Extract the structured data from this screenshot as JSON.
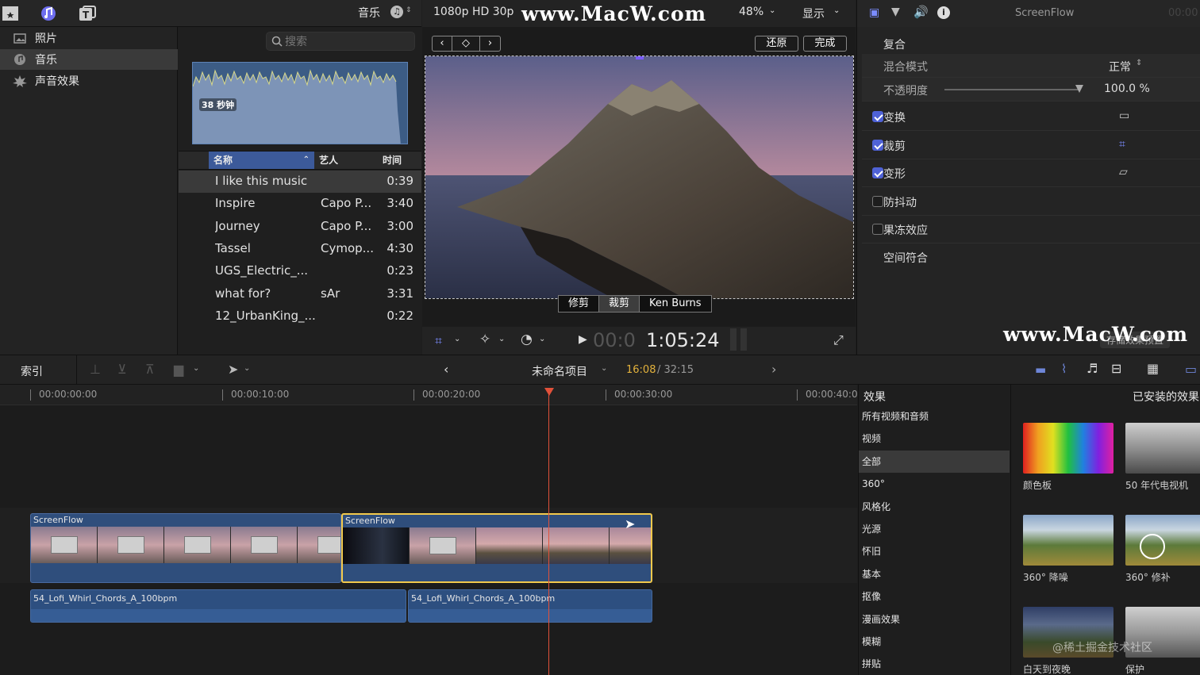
{
  "topbar": {
    "music_label": "音乐"
  },
  "library": {
    "items": [
      {
        "label": "照片",
        "icon": "photo-icon"
      },
      {
        "label": "音乐",
        "icon": "music-icon"
      },
      {
        "label": "声音效果",
        "icon": "sound-effect-icon"
      }
    ]
  },
  "browser": {
    "search_placeholder": "搜索",
    "waveform_badge": "38 秒钟",
    "columns": [
      "名称",
      "艺人",
      "时间"
    ],
    "rows": [
      {
        "name": "I like this music",
        "artist": "",
        "time": "0:39"
      },
      {
        "name": "Inspire",
        "artist": "Capo P...",
        "time": "3:40"
      },
      {
        "name": "Journey",
        "artist": "Capo P...",
        "time": "3:00"
      },
      {
        "name": "Tassel",
        "artist": "Cymop...",
        "time": "4:30"
      },
      {
        "name": "UGS_Electric_...",
        "artist": "",
        "time": "0:23"
      },
      {
        "name": "what for?",
        "artist": "sAr",
        "time": "3:31"
      },
      {
        "name": "12_UrbanKing_...",
        "artist": "",
        "time": "0:22"
      }
    ]
  },
  "viewer": {
    "format": "1080p HD 30p",
    "zoom": "48%",
    "display": "显示",
    "revert": "还原",
    "done": "完成",
    "mode_tabs": [
      "修剪",
      "裁剪",
      "Ken Burns"
    ],
    "timecode_dim": "00:0",
    "timecode": "1:05:24"
  },
  "inspector": {
    "title": "ScreenFlow",
    "time_dim": "00:00",
    "composite": "复合",
    "blend_mode_label": "混合模式",
    "blend_mode_value": "正常",
    "opacity_label": "不透明度",
    "opacity_value": "100.0 %",
    "opacity_level": 1.0,
    "sections": [
      {
        "label": "变换",
        "checked": true
      },
      {
        "label": "裁剪",
        "checked": true
      },
      {
        "label": "变形",
        "checked": true
      },
      {
        "label": "防抖动",
        "checked": false
      },
      {
        "label": "果冻效应",
        "checked": false
      }
    ],
    "spatial": "空间符合",
    "save_preset": "存储效果预置"
  },
  "timeline_toolbar": {
    "index": "索引",
    "project": "未命名项目",
    "position": "16:08",
    "duration": "/ 32:15"
  },
  "timeline": {
    "ruler": [
      "00:00:00:00",
      "00:00:10:00",
      "00:00:20:00",
      "00:00:30:00",
      "00:00:40:0"
    ],
    "clips": [
      "ScreenFlow",
      "ScreenFlow"
    ],
    "audio": [
      "54_Lofi_Whirl_Chords_A_100bpm",
      "54_Lofi_Whirl_Chords_A_100bpm"
    ]
  },
  "effects": {
    "title": "效果",
    "installed_title": "已安装的效果",
    "categories": [
      "所有视频和音频",
      "视频",
      "全部",
      "360°",
      "风格化",
      "光源",
      "怀旧",
      "基本",
      "抠像",
      "漫画效果",
      "模糊",
      "拼贴"
    ],
    "items": [
      "颜色板",
      "50 年代电视机",
      "360° 降噪",
      "360° 修补",
      "白天到夜晚",
      "保护"
    ]
  },
  "watermarks": {
    "top": "www.MacW.com",
    "bottom": "www.MacW.com",
    "credit": "@稀土掘金技术社区"
  },
  "colors": {
    "accent": "#7a5cff",
    "selection": "#f2c94c",
    "playhead": "#e2513a",
    "clip": "#2f4e7c"
  }
}
